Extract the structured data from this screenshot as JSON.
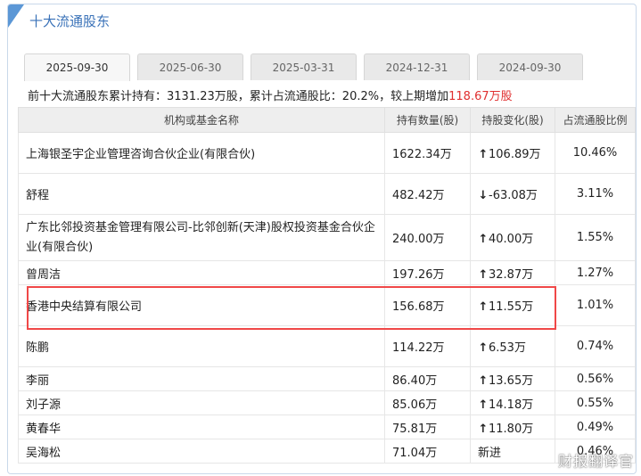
{
  "title": "十大流通股东",
  "tabs": [
    "2025-09-30",
    "2025-06-30",
    "2025-03-31",
    "2024-12-31",
    "2024-09-30"
  ],
  "summary": {
    "prefix": "前十大流通股东累计持有：",
    "holding": "3131.23万股",
    "mid": "，累计占流通股比：",
    "ratio": "20.2%",
    "mid2": "，较上期增加",
    "change": "118.67万股"
  },
  "columns": [
    "机构或基金名称",
    "持有数量(股)",
    "持股变化(股)",
    "占流通股比例"
  ],
  "rows": [
    {
      "name": "上海银圣宇企业管理咨询合伙企业(有限合伙)",
      "qty": "1622.34万",
      "dir": "up",
      "change": "106.89万",
      "pct": "10.46%"
    },
    {
      "name": "舒程",
      "qty": "482.42万",
      "dir": "down",
      "change": "-63.08万",
      "pct": "3.11%"
    },
    {
      "name": "广东比邻投资基金管理有限公司-比邻创新(天津)股权投资基金合伙企业(有限合伙)",
      "qty": "240.00万",
      "dir": "up",
      "change": "40.00万",
      "pct": "1.55%"
    },
    {
      "name": "曾周洁",
      "qty": "197.26万",
      "dir": "up",
      "change": "32.87万",
      "pct": "1.27%"
    },
    {
      "name": "香港中央结算有限公司",
      "qty": "156.68万",
      "dir": "up",
      "change": "11.55万",
      "pct": "1.01%"
    },
    {
      "name": "陈鹏",
      "qty": "114.22万",
      "dir": "up",
      "change": "6.53万",
      "pct": "0.74%"
    },
    {
      "name": "李丽",
      "qty": "86.40万",
      "dir": "up",
      "change": "13.65万",
      "pct": "0.56%"
    },
    {
      "name": "刘子源",
      "qty": "85.06万",
      "dir": "up",
      "change": "14.18万",
      "pct": "0.55%"
    },
    {
      "name": "黄春华",
      "qty": "75.81万",
      "dir": "up",
      "change": "11.80万",
      "pct": "0.49%"
    },
    {
      "name": "吴海松",
      "qty": "71.04万",
      "dir": "new",
      "change": "新进",
      "pct": "0.46%"
    }
  ],
  "icons": {
    "up": "arrow-up-icon",
    "down": "arrow-down-icon"
  },
  "colors": {
    "up": "#e03030",
    "down": "#3c9a2e",
    "accent": "#3a72b8",
    "highlight": "#f04848"
  },
  "watermark": "财报翻译官"
}
